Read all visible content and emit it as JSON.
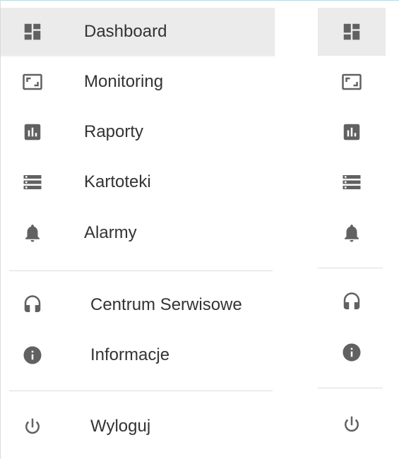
{
  "colors": {
    "icon": "#616161",
    "text": "#333333",
    "active_bg": "#ebebeb",
    "divider": "#dcdcdc"
  },
  "sidebar": {
    "items": [
      {
        "label": "Dashboard",
        "icon": "dashboard-icon",
        "active": true
      },
      {
        "label": "Monitoring",
        "icon": "aspect-ratio-icon",
        "active": false
      },
      {
        "label": "Raporty",
        "icon": "bar-chart-icon",
        "active": false
      },
      {
        "label": "Kartoteki",
        "icon": "list-storage-icon",
        "active": false
      },
      {
        "label": "Alarmy",
        "icon": "bell-icon",
        "active": false
      }
    ],
    "support_items": [
      {
        "label": "Centrum Serwisowe",
        "icon": "headset-icon"
      },
      {
        "label": "Informacje",
        "icon": "info-icon"
      }
    ],
    "logout": {
      "label": "Wyloguj",
      "icon": "power-icon"
    }
  }
}
